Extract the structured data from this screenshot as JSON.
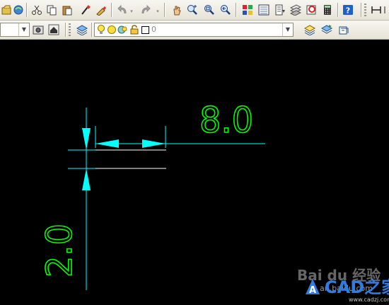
{
  "toolbar_standard": {
    "icons": [
      "open-icon",
      "publish-icon",
      "cut-icon",
      "copy-icon",
      "paste-icon",
      "match-properties-icon",
      "block-editor-icon",
      "undo-icon",
      "redo-icon",
      "pan-icon",
      "zoom-realtime-icon",
      "zoom-window-icon",
      "zoom-previous-icon",
      "properties-icon",
      "design-center-icon",
      "tool-palettes-icon",
      "sheet-set-icon",
      "markup-icon",
      "calculator-icon",
      "help-icon",
      "linear-dimension-icon"
    ]
  },
  "toolbar_layers": {
    "left_combo_value": "",
    "layer_combo_value": "0",
    "icons": [
      "layer-properties-icon",
      "layer-state-icons",
      "make-current-icon",
      "layer-previous-icon",
      "layer-walk-icon"
    ]
  },
  "drawing": {
    "dim_horizontal": "8.0",
    "dim_vertical": "2.0"
  },
  "watermark": {
    "baidu_text": "Bai du 经验",
    "baidu_url": "an.baidu.com",
    "cad_text": "CAD之家",
    "cad_url": "www.cadzj.com"
  },
  "colors": {
    "canvas": "#000000",
    "dimension_cyan": "#00ffff",
    "text_green": "#00ff00",
    "geometry_white": "#ffffff"
  }
}
